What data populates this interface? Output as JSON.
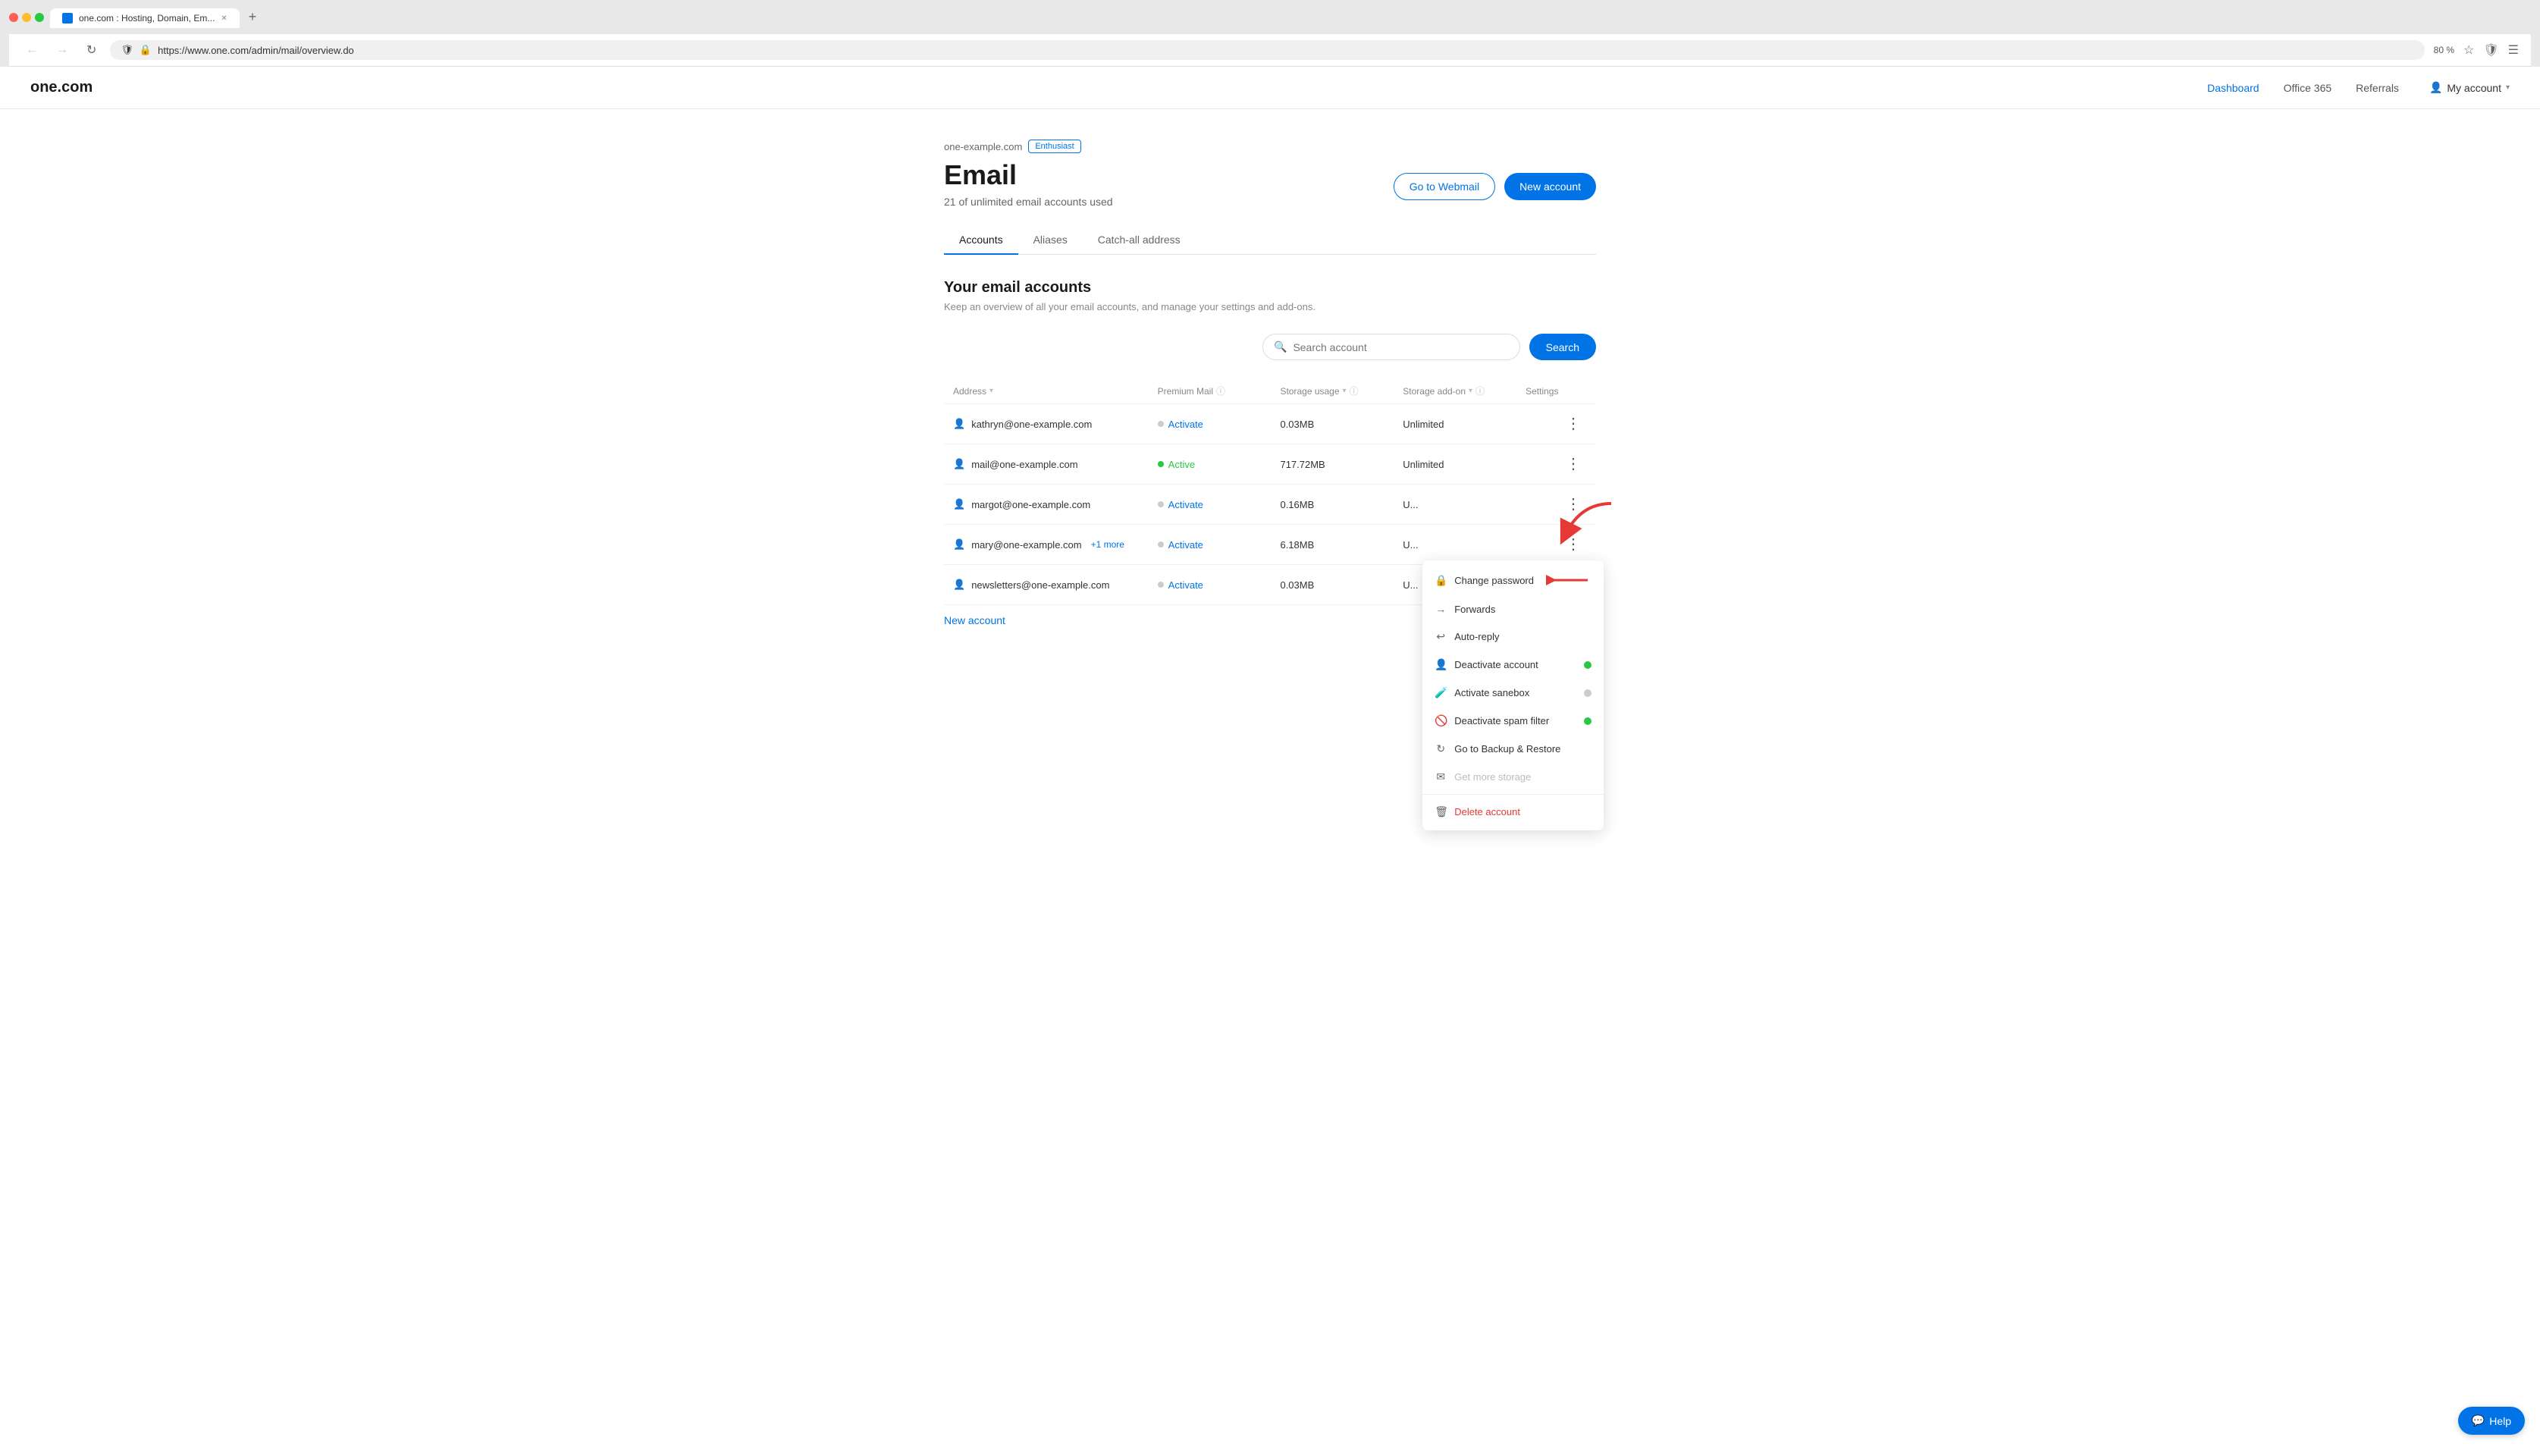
{
  "browser": {
    "tab_title": "one.com : Hosting, Domain, Em...",
    "url": "https://www.one.com/admin/mail/overview.do",
    "zoom": "80 %",
    "new_tab_label": "+"
  },
  "topnav": {
    "logo": "one.com",
    "links": [
      {
        "label": "Dashboard",
        "active": true
      },
      {
        "label": "Office 365",
        "active": false
      },
      {
        "label": "Referrals",
        "active": false
      }
    ],
    "my_account": "My account"
  },
  "page": {
    "domain": "one-example.com",
    "badge": "Enthusiast",
    "title": "Email",
    "subtitle": "21 of unlimited email accounts used",
    "btn_webmail": "Go to Webmail",
    "btn_new": "New account"
  },
  "tabs": [
    {
      "label": "Accounts",
      "active": true
    },
    {
      "label": "Aliases",
      "active": false
    },
    {
      "label": "Catch-all address",
      "active": false
    }
  ],
  "accounts_section": {
    "title": "Your email accounts",
    "description": "Keep an overview of all your email accounts, and manage your settings and add-ons."
  },
  "search": {
    "placeholder": "Search account",
    "btn_label": "Search"
  },
  "table": {
    "columns": [
      {
        "label": "Address",
        "sortable": true
      },
      {
        "label": "Premium Mail",
        "info": true
      },
      {
        "label": "Storage usage",
        "sortable": true,
        "info": true
      },
      {
        "label": "Storage add-on",
        "sortable": true,
        "info": true
      },
      {
        "label": "Settings"
      }
    ],
    "rows": [
      {
        "email": "kathryn@one-example.com",
        "extra": null,
        "status": "Activate",
        "status_type": "inactive",
        "storage": "0.03MB",
        "addon": "Unlimited"
      },
      {
        "email": "mail@one-example.com",
        "extra": null,
        "status": "Active",
        "status_type": "active",
        "storage": "717.72MB",
        "addon": "Unlimited"
      },
      {
        "email": "margot@one-example.com",
        "extra": null,
        "status": "Activate",
        "status_type": "inactive",
        "storage": "0.16MB",
        "addon": "U..."
      },
      {
        "email": "mary@one-example.com",
        "extra": "+1 more",
        "status": "Activate",
        "status_type": "inactive",
        "storage": "6.18MB",
        "addon": "U..."
      },
      {
        "email": "newsletters@one-example.com",
        "extra": null,
        "status": "Activate",
        "status_type": "inactive",
        "storage": "0.03MB",
        "addon": "U..."
      }
    ],
    "new_account_link": "New account"
  },
  "dropdown": {
    "items": [
      {
        "icon": "🔒",
        "label": "Change password",
        "type": "normal",
        "toggle": null
      },
      {
        "icon": "→",
        "label": "Forwards",
        "type": "normal",
        "toggle": null
      },
      {
        "icon": "↩",
        "label": "Auto-reply",
        "type": "normal",
        "toggle": null
      },
      {
        "icon": "👤",
        "label": "Deactivate account",
        "type": "normal",
        "toggle": "on"
      },
      {
        "icon": "🧪",
        "label": "Activate sanebox",
        "type": "normal",
        "toggle": "off"
      },
      {
        "icon": "🚫",
        "label": "Deactivate spam filter",
        "type": "normal",
        "toggle": "on"
      },
      {
        "icon": "↻",
        "label": "Go to Backup & Restore",
        "type": "normal",
        "toggle": null
      },
      {
        "icon": "✉",
        "label": "Get more storage",
        "type": "disabled",
        "toggle": null
      },
      {
        "icon": "🗑",
        "label": "Delete account",
        "type": "danger",
        "toggle": null
      }
    ]
  },
  "help": {
    "label": "Help"
  }
}
